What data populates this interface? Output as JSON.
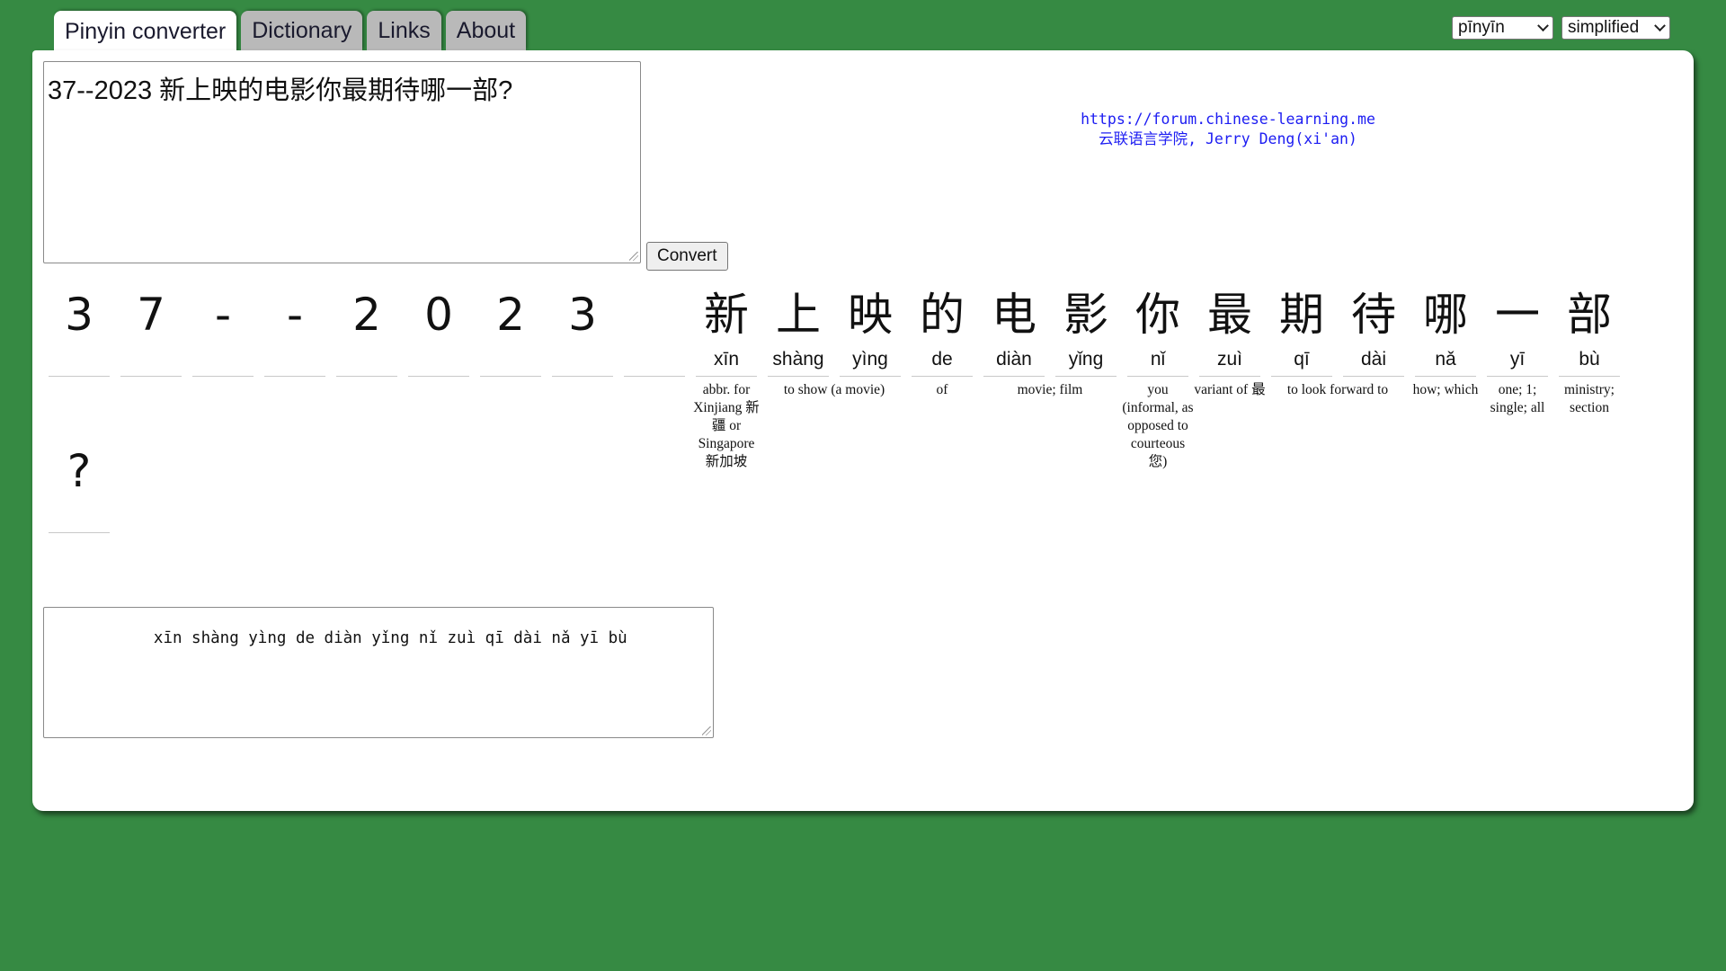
{
  "tabs": [
    {
      "label": "Pinyin converter",
      "active": true
    },
    {
      "label": "Dictionary",
      "active": false
    },
    {
      "label": "Links",
      "active": false
    },
    {
      "label": "About",
      "active": false
    }
  ],
  "selects": {
    "romanization": "pīnyīn",
    "script": "simplified"
  },
  "input": {
    "value": "37--2023 新上映的电影你最期待哪一部?"
  },
  "convert_label": "Convert",
  "credit": {
    "url": "https://forum.chinese-learning.me",
    "line2": "云联语言学院, Jerry Deng(xi'an)"
  },
  "chars": [
    {
      "ch": "3",
      "py": "",
      "def": ""
    },
    {
      "ch": "7",
      "py": "",
      "def": ""
    },
    {
      "ch": "-",
      "py": "",
      "def": ""
    },
    {
      "ch": "-",
      "py": "",
      "def": ""
    },
    {
      "ch": "2",
      "py": "",
      "def": ""
    },
    {
      "ch": "0",
      "py": "",
      "def": ""
    },
    {
      "ch": "2",
      "py": "",
      "def": ""
    },
    {
      "ch": "3",
      "py": "",
      "def": ""
    },
    {
      "ch": "",
      "py": "",
      "def": ""
    },
    {
      "ch": "新",
      "py": "xīn",
      "def": "abbr. for Xinjiang 新疆 or Singapore 新加坡"
    },
    {
      "ch": "上",
      "py": "shàng",
      "def": "to show (a movie)"
    },
    {
      "ch": "映",
      "py": "yìng",
      "def": ""
    },
    {
      "ch": "的",
      "py": "de",
      "def": "of"
    },
    {
      "ch": "电",
      "py": "diàn",
      "def": "movie; film"
    },
    {
      "ch": "影",
      "py": "yǐng",
      "def": ""
    },
    {
      "ch": "你",
      "py": "nǐ",
      "def": "you (informal, as opposed to courteous 您)"
    },
    {
      "ch": "最",
      "py": "zuì",
      "def": "variant of 最"
    },
    {
      "ch": "期",
      "py": "qī",
      "def": "to look forward to"
    },
    {
      "ch": "待",
      "py": "dài",
      "def": ""
    },
    {
      "ch": "哪",
      "py": "nǎ",
      "def": "how; which"
    },
    {
      "ch": "一",
      "py": "yī",
      "def": "one; 1; single; all"
    },
    {
      "ch": "部",
      "py": "bù",
      "def": "ministry; section"
    },
    {
      "ch": "?",
      "py": "",
      "def": ""
    }
  ],
  "output": {
    "value": "       xīn shàng yìng de diàn yǐng nǐ zuì qī dài nǎ yī bù"
  }
}
